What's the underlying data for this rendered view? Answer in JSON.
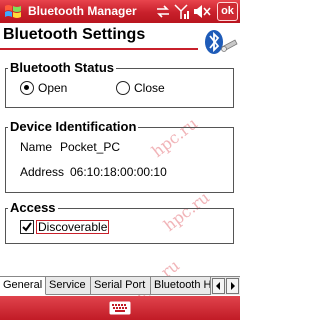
{
  "window": {
    "title": "Bluetooth Manager",
    "ok_label": "ok"
  },
  "page": {
    "title": "Bluetooth Settings"
  },
  "status": {
    "group_label": "Bluetooth Status",
    "open_label": "Open",
    "close_label": "Close",
    "selected": "Open"
  },
  "device": {
    "group_label": "Device Identification",
    "name_label": "Name",
    "name_value": "Pocket_PC",
    "address_label": "Address",
    "address_value": "06:10:18:00:00:10"
  },
  "access": {
    "group_label": "Access",
    "discoverable_label": "Discoverable",
    "discoverable_checked": true
  },
  "tabs": [
    {
      "label": "General"
    },
    {
      "label": "Service"
    },
    {
      "label": "Serial Port"
    },
    {
      "label": "Bluetooth H"
    }
  ],
  "watermark": "hpc.ru",
  "colors": {
    "brand_red": "#c8202b",
    "watermark": "#f1b4b8"
  }
}
